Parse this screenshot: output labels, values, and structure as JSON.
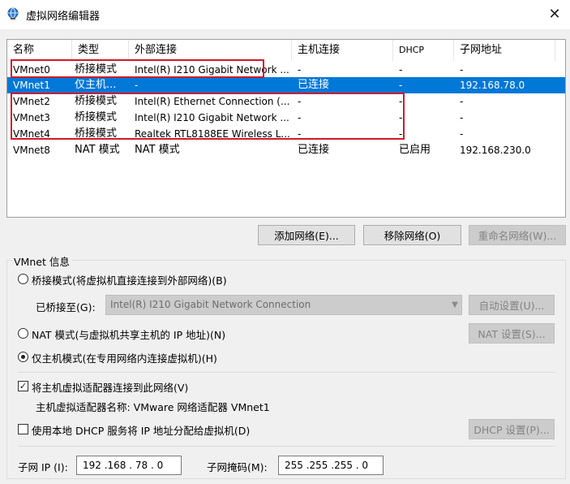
{
  "window": {
    "title": "虚拟网络编辑器",
    "icon": "network-globe-icon",
    "close_glyph": "✕"
  },
  "table": {
    "headers": [
      "名称",
      "类型",
      "外部连接",
      "主机连接",
      "DHCP",
      "子网地址"
    ],
    "rows": [
      {
        "name": "VMnet0",
        "type": "桥接模式",
        "external": "Intel(R) I210 Gigabit Network ...",
        "host": "-",
        "dhcp": "-",
        "subnet": "-"
      },
      {
        "name": "VMnet1",
        "type": "仅主机...",
        "external": "-",
        "host": "已连接",
        "dhcp": "-",
        "subnet": "192.168.78.0"
      },
      {
        "name": "VMnet2",
        "type": "桥接模式",
        "external": "Intel(R) Ethernet Connection (...",
        "host": "-",
        "dhcp": "-",
        "subnet": "-"
      },
      {
        "name": "VMnet3",
        "type": "桥接模式",
        "external": "Intel(R) I210 Gigabit Network ...",
        "host": "-",
        "dhcp": "-",
        "subnet": "-"
      },
      {
        "name": "VMnet4",
        "type": "桥接模式",
        "external": "Realtek RTL8188EE Wireless L...",
        "host": "-",
        "dhcp": "-",
        "subnet": "-"
      },
      {
        "name": "VMnet8",
        "type": "NAT 模式",
        "external": "NAT 模式",
        "host": "已连接",
        "dhcp": "已启用",
        "subnet": "192.168.230.0"
      }
    ]
  },
  "buttons": {
    "add_network": "添加网络(E)...",
    "remove_network": "移除网络(O)",
    "rename_network": "重命名网络(W)..."
  },
  "vmnet_info": {
    "group_label": "VMnet 信息",
    "bridged_label": "桥接模式(将虚拟机直接连接到外部网络)(B)",
    "bridged_to_label": "已桥接至(G):",
    "bridged_to_value": "Intel(R) I210 Gigabit Network Connection",
    "auto_settings": "自动设置(U)...",
    "nat_label": "NAT 模式(与虚拟机共享主机的 IP 地址)(N)",
    "nat_settings": "NAT 设置(S)...",
    "hostonly_label": "仅主机模式(在专用网络内连接虚拟机)(H)",
    "connect_adapter_label": "将主机虚拟适配器连接到此网络(V)",
    "adapter_name_label": "主机虚拟适配器名称: VMware 网络适配器 VMnet1",
    "local_dhcp_label": "使用本地 DHCP 服务将 IP 地址分配给虚拟机(D)",
    "dhcp_settings": "DHCP 设置(P)...",
    "subnet_ip_label": "子网 IP (I):",
    "subnet_ip_value": "192 .168 . 78 . 0",
    "subnet_mask_label": "子网掩码(M):",
    "subnet_mask_value": "255 .255 .255 . 0",
    "mode_selected": "hostonly",
    "connect_adapter_checked": true,
    "local_dhcp_checked": false
  },
  "colors": {
    "selection": "#0078d7",
    "annotation": "#d01a2b"
  }
}
